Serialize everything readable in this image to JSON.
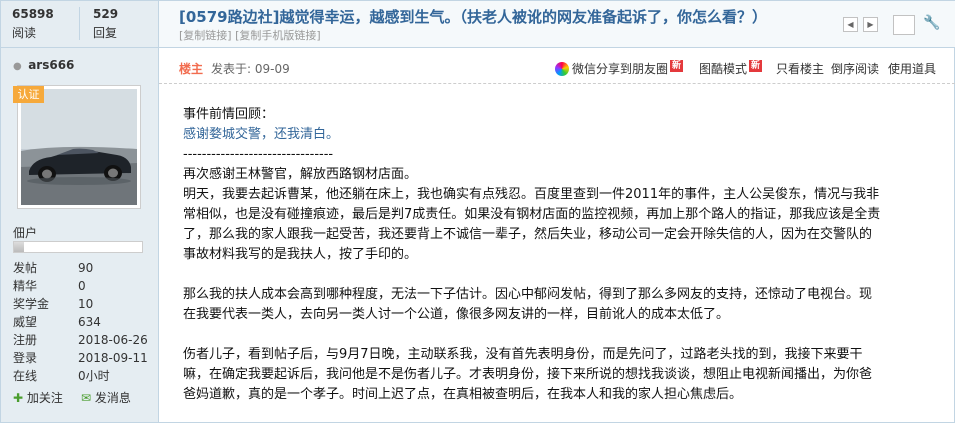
{
  "sidebar": {
    "stats": [
      {
        "value": "65898",
        "label": "阅读"
      },
      {
        "value": "529",
        "label": "回复"
      }
    ],
    "author": "ars666",
    "badge": "认证",
    "rank": "佃户",
    "rank_progress": 0.08,
    "profile": [
      {
        "key": "发帖",
        "value": "90"
      },
      {
        "key": "精华",
        "value": "0"
      },
      {
        "key": "奖学金",
        "value": "10"
      },
      {
        "key": "威望",
        "value": "634"
      },
      {
        "key": "注册",
        "value": "2018-06-26"
      },
      {
        "key": "登录",
        "value": "2018-09-11"
      },
      {
        "key": "在线",
        "value": "0小时"
      }
    ],
    "actions": {
      "follow": "加关注",
      "message": "发消息"
    }
  },
  "header": {
    "title": "[0579路边社]越觉得幸运，越感到生气。（扶老人被讹的网友准备起诉了，你怎么看？）",
    "copy_link": "[复制链接]",
    "copy_mobile_link": "[复制手机版链接]"
  },
  "post_meta": {
    "floor": "楼主",
    "posted": "发表于: 09-09",
    "share_wechat": "微信分享到朋友圈",
    "new_tag": "新",
    "image_mode": "图酷模式",
    "only_op": "只看楼主",
    "reverse": "倒序阅读",
    "tools": "使用道具"
  },
  "post": {
    "intro": "事件前情回顾：",
    "link": "感谢婺城交警，还我清白。",
    "divider": "--------------------------------",
    "lines": [
      "再次感谢王林警官，解放西路钢材店面。",
      "明天，我要去起诉曹某，他还躺在床上，我也确实有点残忍。百度里查到一件2011年的事件，主人公吴俊东，情况与我非",
      "常相似，也是没有碰撞痕迹，最后是判7成责任。如果没有钢材店面的监控视频，再加上那个路人的指证，那我应该是全责",
      "了，那么我的家人跟我一起受苦，我还要背上不诚信一辈子，然后失业，移动公司一定会开除失信的人，因为在交警队的",
      "事故材料我写的是我扶人，按了手印的。"
    ],
    "para2": [
      "那么我的扶人成本会高到哪种程度，无法一下子估计。因心中郁闷发帖，得到了那么多网友的支持，还惊动了电视台。现",
      "在我要代表一类人，去向另一类人讨一个公道，像很多网友讲的一样，目前讹人的成本太低了。"
    ],
    "para3": [
      "伤者儿子，看到帖子后，与9月7日晚，主动联系我，没有首先表明身份，而是先问了，过路老头找的到，我接下来要干",
      "嘛，在确定我要起诉后，我问他是不是伤者儿子。才表明身份，接下来所说的想找我谈谈，想阻止电视新闻播出，为你爸",
      "爸妈道歉，真的是一个孝子。时间上迟了点，在真相被查明后，在我本人和我的家人担心焦虑后。"
    ]
  }
}
